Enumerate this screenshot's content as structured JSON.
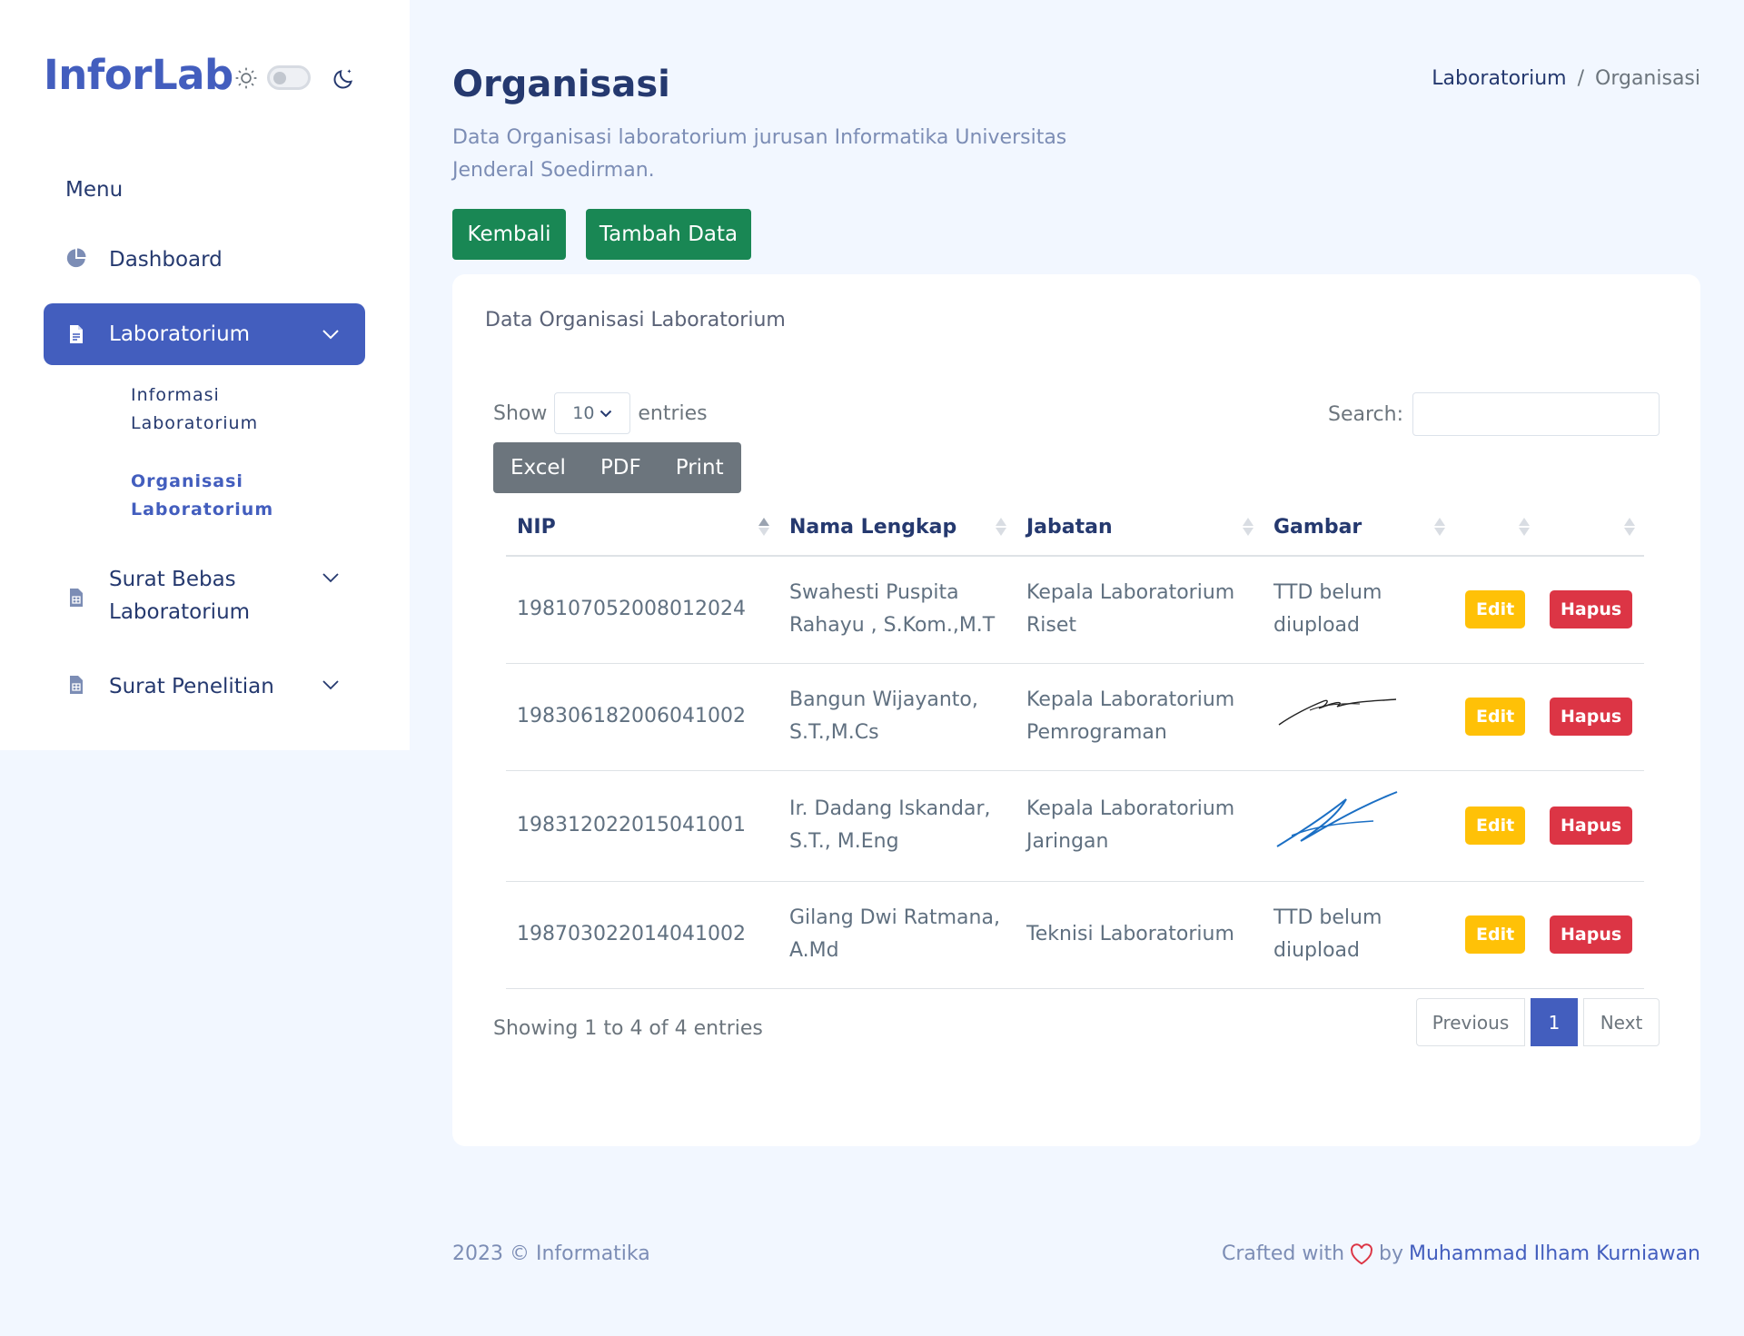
{
  "sidebar": {
    "brand": "InforLab",
    "menu_title": "Menu",
    "items": [
      {
        "label": "Dashboard",
        "icon": "pie-chart-icon"
      },
      {
        "label": "Laboratorium",
        "icon": "file-icon",
        "active": true
      },
      {
        "label": "Surat Bebas Laboratorium",
        "icon": "file-spreadsheet-icon"
      },
      {
        "label": "Surat Penelitian",
        "icon": "file-spreadsheet-icon"
      }
    ],
    "subitems": [
      {
        "label": "Informasi Laboratorium"
      },
      {
        "label": "Organisasi Laboratorium",
        "active": true
      }
    ]
  },
  "header": {
    "title": "Organisasi",
    "subtitle": "Data Organisasi laboratorium jurusan Informatika Universitas Jenderal Soedirman.",
    "breadcrumb": [
      "Laboratorium",
      "Organisasi"
    ],
    "breadcrumb_separator": "/"
  },
  "actions": {
    "back_label": "Kembali",
    "add_label": "Tambah Data"
  },
  "card": {
    "title": "Data Organisasi Laboratorium",
    "show_label": "Show",
    "entries_value": "10",
    "entries_label": "entries",
    "search_label": "Search:",
    "search_value": "",
    "export_buttons": [
      "Excel",
      "PDF",
      "Print"
    ],
    "columns": [
      "NIP",
      "Nama Lengkap",
      "Jabatan",
      "Gambar",
      "",
      ""
    ],
    "rows": [
      {
        "nip": "198107052008012024",
        "nama": "Swahesti Puspita Rahayu , S.Kom.,M.T",
        "jabatan": "Kepala Laboratorium Riset",
        "gambar": "TTD belum diupload",
        "edit": "Edit",
        "hapus": "Hapus"
      },
      {
        "nip": "198306182006041002",
        "nama": "Bangun Wijayanto, S.T.,M.Cs",
        "jabatan": "Kepala Laboratorium Pemrograman",
        "gambar": "",
        "edit": "Edit",
        "hapus": "Hapus"
      },
      {
        "nip": "198312022015041001",
        "nama": "Ir. Dadang Iskandar, S.T., M.Eng",
        "jabatan": "Kepala Laboratorium Jaringan",
        "gambar": "",
        "edit": "Edit",
        "hapus": "Hapus"
      },
      {
        "nip": "198703022014041002",
        "nama": "Gilang Dwi Ratmana, A.Md",
        "jabatan": "Teknisi Laboratorium",
        "gambar": "TTD belum diupload",
        "edit": "Edit",
        "hapus": "Hapus"
      }
    ],
    "info": "Showing 1 to 4 of 4 entries",
    "pagination": {
      "previous": "Previous",
      "current": "1",
      "next": "Next"
    }
  },
  "footer": {
    "left": "2023 © Informatika",
    "crafted": "Crafted with",
    "by": "by",
    "author": "Muhammad Ilham Kurniawan"
  },
  "colors": {
    "primary": "#435ebe",
    "success": "#198754",
    "warning": "#ffc107",
    "danger": "#dc3545",
    "background": "#f2f7ff"
  }
}
